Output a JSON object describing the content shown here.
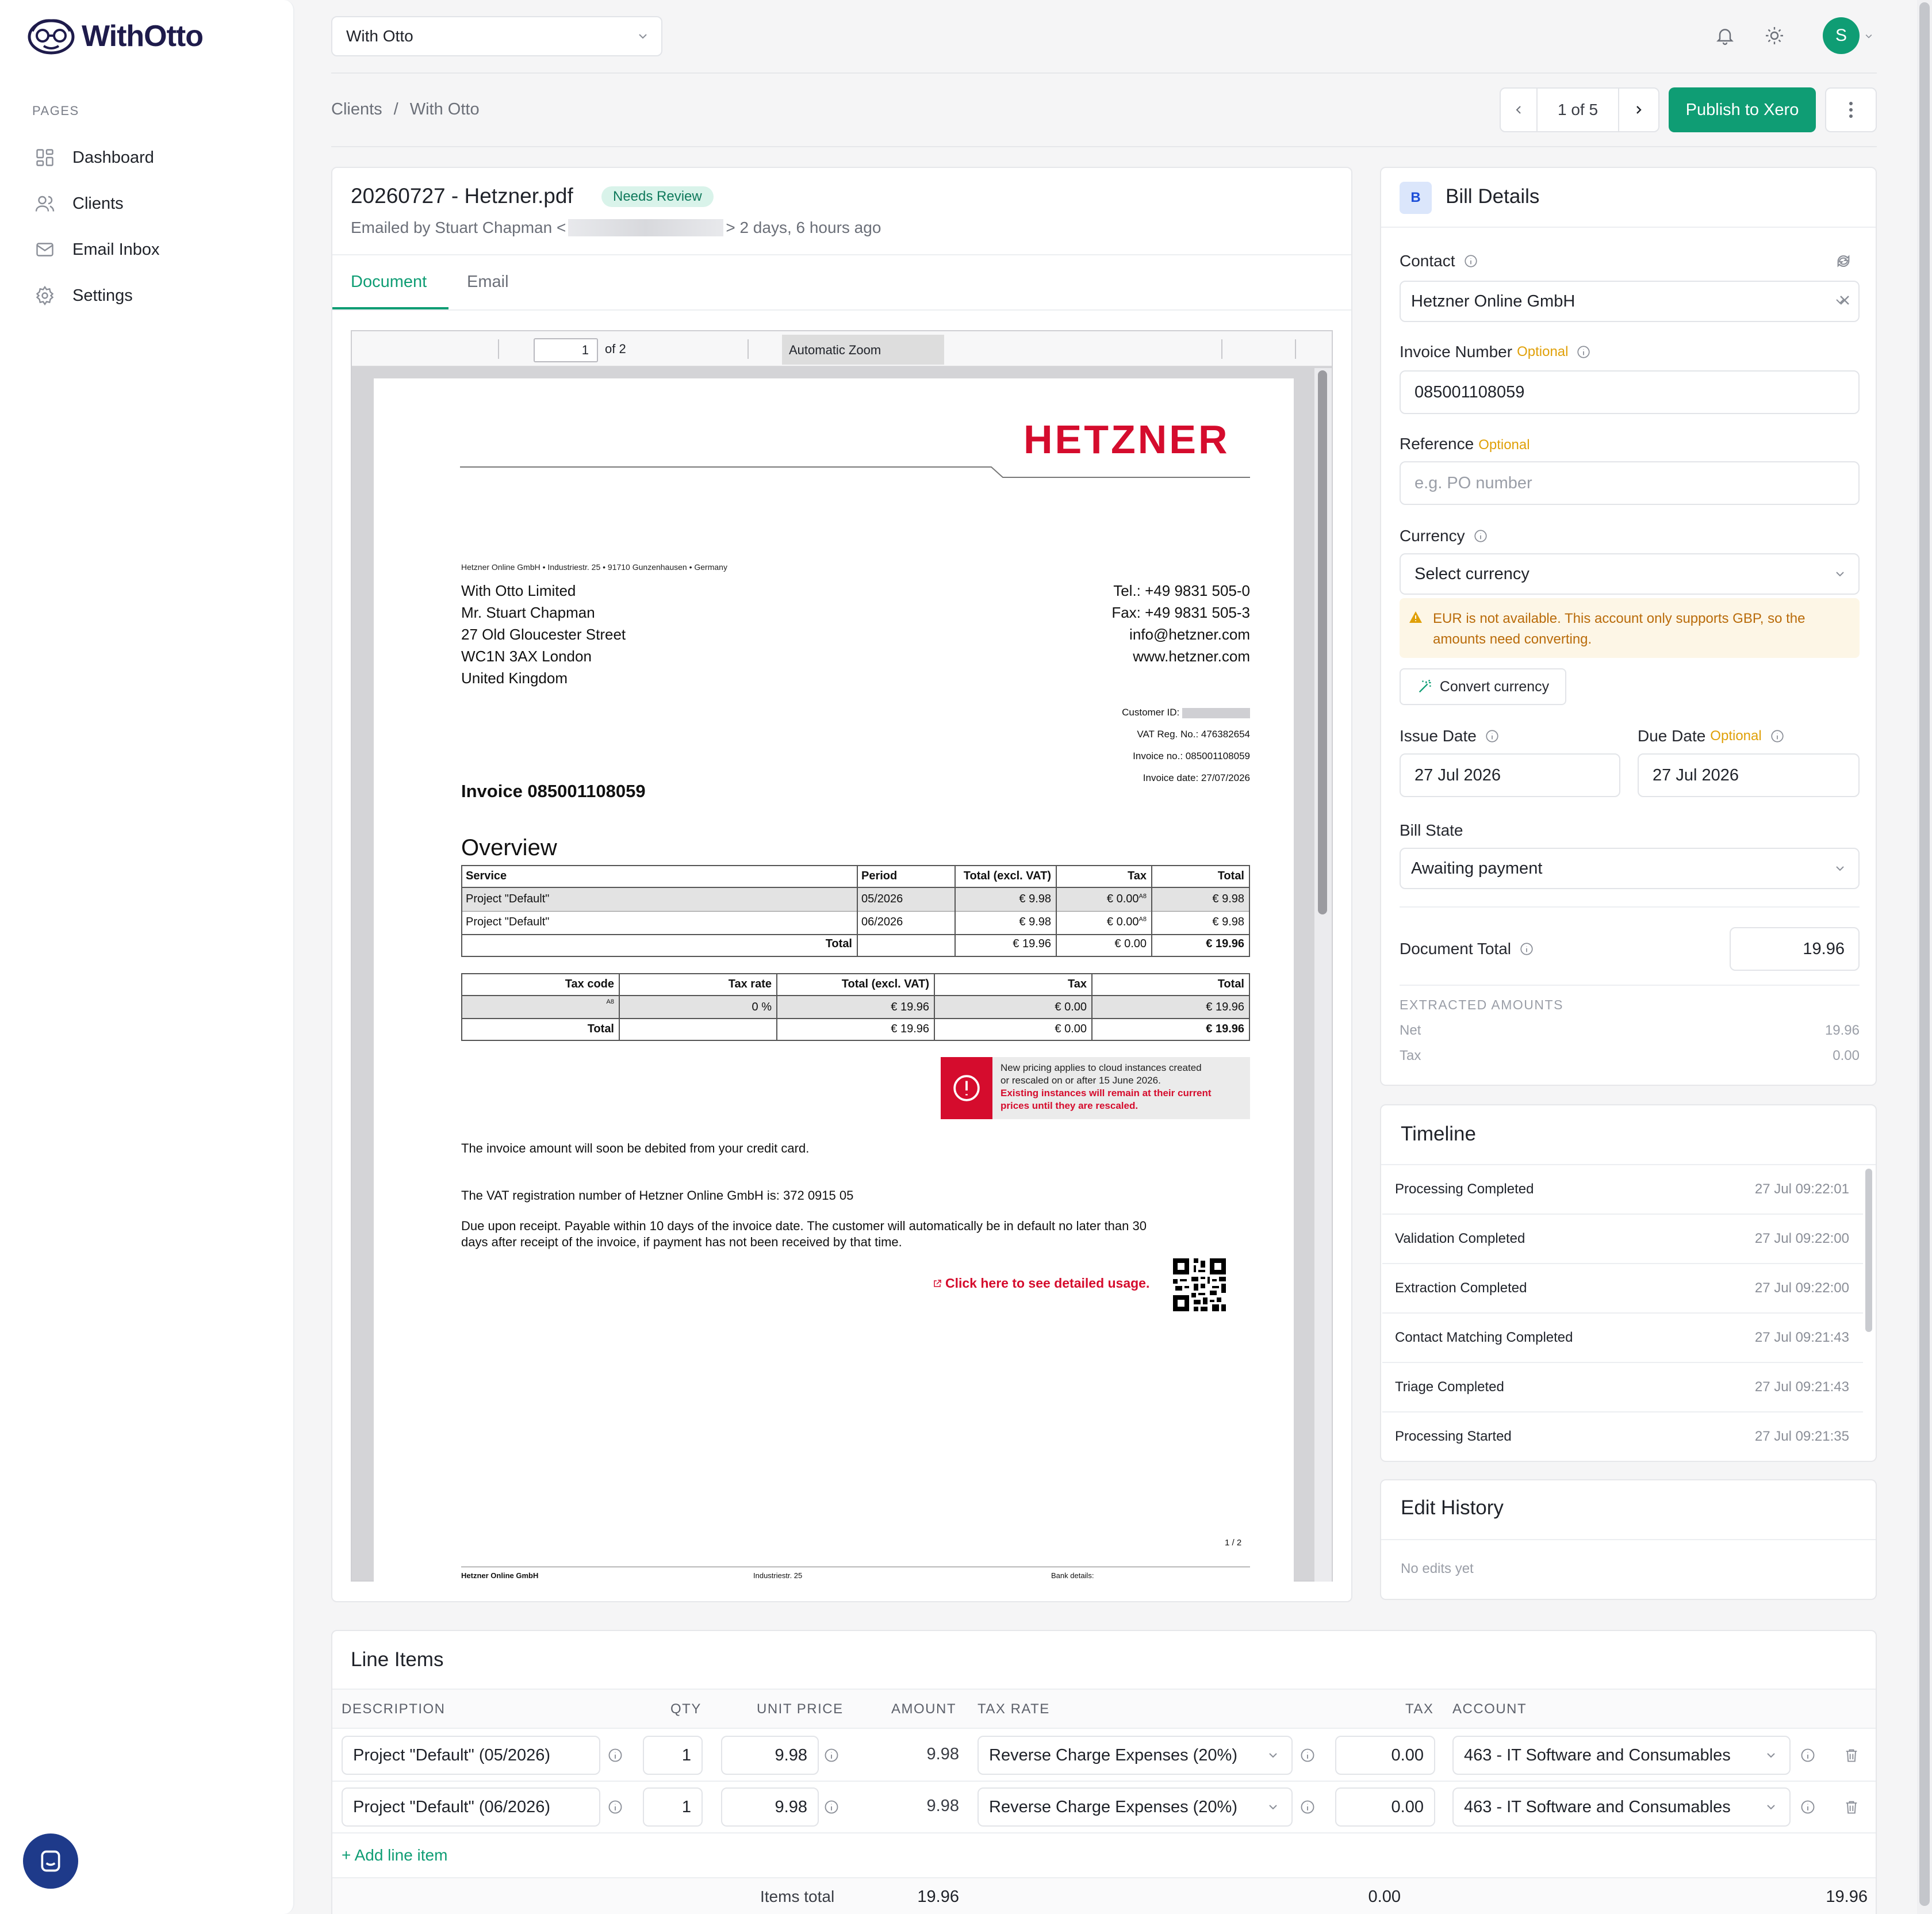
{
  "app": {
    "brand": "WithOtto"
  },
  "sidebar": {
    "section": "PAGES",
    "items": [
      {
        "label": "Dashboard",
        "icon": "dashboard-icon"
      },
      {
        "label": "Clients",
        "icon": "users-icon"
      },
      {
        "label": "Email Inbox",
        "icon": "mail-icon"
      },
      {
        "label": "Settings",
        "icon": "gear-icon"
      }
    ]
  },
  "topbar": {
    "org_select": "With Otto",
    "avatar": "S"
  },
  "breadcrumb": {
    "parent": "Clients",
    "sep": "/",
    "current": "With Otto"
  },
  "pager": {
    "label": "1 of 5"
  },
  "actions": {
    "publish": "Publish to Xero"
  },
  "doc": {
    "title": "20260727 - Hetzner.pdf",
    "badge": "Needs Review",
    "emailed_prefix": "Emailed by Stuart Chapman <",
    "emailed_suffix": "> 2 days, 6 hours ago",
    "tabs": [
      "Document",
      "Email"
    ]
  },
  "viewer": {
    "page_input": "1",
    "of_pages": "of 2",
    "zoom": "Automatic Zoom"
  },
  "invoice": {
    "logo": "HETZNER",
    "sender_line": "Hetzner Online GmbH • Industriestr. 25 • 91710 Gunzenhausen • Germany",
    "address": [
      "With Otto Limited",
      "Mr. Stuart Chapman",
      "27 Old Gloucester Street",
      "WC1N 3AX London",
      "United Kingdom"
    ],
    "contact": [
      "Tel.: +49 9831 505-0",
      "Fax: +49 9831 505-3",
      "info@hetzner.com",
      "www.hetzner.com"
    ],
    "meta": {
      "customer_id": "Customer ID:",
      "vat_reg": "VAT Reg. No.: 476382654",
      "invoice_no": "Invoice no.: 085001108059",
      "invoice_date": "Invoice date: 27/07/2026"
    },
    "heading": "Invoice 085001108059",
    "overview": "Overview",
    "overview_table": {
      "headers": [
        "Service",
        "Period",
        "Total (excl. VAT)",
        "Tax",
        "Total"
      ],
      "rows": [
        [
          "Project \"Default\"",
          "05/2026",
          "€ 9.98",
          "€ 0.00",
          "€ 9.98"
        ],
        [
          "Project \"Default\"",
          "06/2026",
          "€ 9.98",
          "€ 0.00",
          "€ 9.98"
        ]
      ],
      "sup": "A8",
      "total": [
        "Total",
        "€ 19.96",
        "€ 0.00",
        "€ 19.96"
      ]
    },
    "tax_table": {
      "headers": [
        "Tax code",
        "Tax rate",
        "Total (excl. VAT)",
        "Tax",
        "Total"
      ],
      "row": [
        "A8",
        "0 %",
        "€ 19.96",
        "€ 0.00",
        "€ 19.96"
      ],
      "total": [
        "Total",
        "€ 19.96",
        "€ 0.00",
        "€ 19.96"
      ]
    },
    "notice": {
      "line1": "New pricing applies to cloud instances created",
      "line2": "or rescaled on or after 15 June 2026.",
      "line3": "Existing instances will remain at their current",
      "line4": "prices until they are rescaled."
    },
    "p1": "The invoice amount will soon be debited from your credit card.",
    "p2": "The VAT registration number of Hetzner Online GmbH is: 372 0915 05",
    "p3a": "Due upon receipt. Payable within 10 days of the invoice date. The customer will automatically be in default no later than 30",
    "p3b": "days after receipt of the invoice, if payment has not been received by that time.",
    "usage_link": "Click here to see detailed usage.",
    "page_no": "1 / 2",
    "footer": [
      "Hetzner Online GmbH",
      "Industriestr. 25",
      "Bank details:"
    ]
  },
  "bill": {
    "badge": "B",
    "title": "Bill Details",
    "contact_label": "Contact",
    "contact_value": "Hetzner Online GmbH",
    "invoice_label": "Invoice Number",
    "optional": "Optional",
    "invoice_value": "085001108059",
    "reference_label": "Reference",
    "reference_placeholder": "e.g. PO number",
    "currency_label": "Currency",
    "currency_value": "Select currency",
    "warning": "EUR is not available. This account only supports GBP, so the amounts need converting.",
    "warning_l1": "EUR is not available. This account only supports GBP, so the",
    "warning_l2": "amounts need converting.",
    "convert": "Convert currency",
    "issue_label": "Issue Date",
    "issue_value": "27 Jul 2026",
    "due_label": "Due Date",
    "due_value": "27 Jul 2026",
    "state_label": "Bill State",
    "state_value": "Awaiting payment",
    "total_label": "Document Total",
    "total_value": "19.96",
    "extracted_title": "EXTRACTED AMOUNTS",
    "net_label": "Net",
    "net_value": "19.96",
    "tax_label": "Tax",
    "tax_value": "0.00"
  },
  "timeline": {
    "title": "Timeline",
    "items": [
      {
        "label": "Processing Completed",
        "date": "27 Jul 09:22:01"
      },
      {
        "label": "Validation Completed",
        "date": "27 Jul 09:22:00"
      },
      {
        "label": "Extraction Completed",
        "date": "27 Jul 09:22:00"
      },
      {
        "label": "Contact Matching Completed",
        "date": "27 Jul 09:21:43"
      },
      {
        "label": "Triage Completed",
        "date": "27 Jul 09:21:43"
      },
      {
        "label": "Processing Started",
        "date": "27 Jul 09:21:35"
      }
    ]
  },
  "edit_history": {
    "title": "Edit History",
    "empty": "No edits yet"
  },
  "line_items": {
    "title": "Line Items",
    "headers": {
      "description": "DESCRIPTION",
      "qty": "QTY",
      "unit_price": "UNIT PRICE",
      "amount": "AMOUNT",
      "tax_rate": "TAX RATE",
      "tax": "TAX",
      "account": "ACCOUNT"
    },
    "rows": [
      {
        "description": "Project \"Default\" (05/2026)",
        "qty": "1",
        "unit_price": "9.98",
        "amount": "9.98",
        "tax_rate": "Reverse Charge Expenses (20%)",
        "tax": "0.00",
        "account": "463 - IT Software and Consumables"
      },
      {
        "description": "Project \"Default\" (06/2026)",
        "qty": "1",
        "unit_price": "9.98",
        "amount": "9.98",
        "tax_rate": "Reverse Charge Expenses (20%)",
        "tax": "0.00",
        "account": "463 - IT Software and Consumables"
      }
    ],
    "add": "+ Add line item",
    "totals": {
      "label": "Items total",
      "amount": "19.96",
      "tax": "0.00",
      "total": "19.96"
    }
  },
  "colors": {
    "accent": "#0f9d74",
    "warning_bg": "#fdf6e6",
    "hetzner_red": "#d50c2d"
  }
}
